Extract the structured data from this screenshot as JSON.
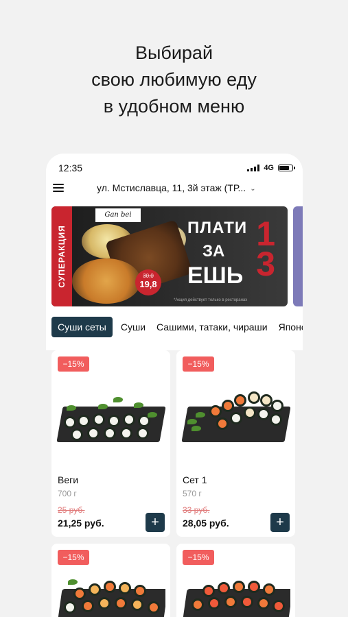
{
  "headline": {
    "line1": "Выбирай",
    "line2": "свою любимую еду",
    "line3": "в удобном меню"
  },
  "status_bar": {
    "time": "12:35",
    "network": "4G"
  },
  "app_bar": {
    "address": "ул. Мстиславца, 11, 3й этаж (ТР...",
    "menu_icon": "hamburger-icon",
    "dropdown_icon": "chevron-down-icon"
  },
  "banner": {
    "side_label": "СУПЕРАКЦИЯ",
    "logo_text": "Gan bei",
    "price_old": "30,0",
    "price_new": "19,8",
    "promo_line1": "ПЛАТИ",
    "promo_line2": "ЗА",
    "promo_line3": "ЕШЬ",
    "promo_number1": "1",
    "promo_number2": "3",
    "note": "*Акция действует только в ресторанах"
  },
  "categories": [
    {
      "label": "Суши сеты",
      "active": true
    },
    {
      "label": "Суши",
      "active": false
    },
    {
      "label": "Сашими, татаки, чираши",
      "active": false
    },
    {
      "label": "Японс",
      "active": false
    }
  ],
  "products": [
    {
      "discount": "−15%",
      "name": "Веги",
      "weight": "700 г",
      "old_price": "25 руб.",
      "price": "21,25 руб.",
      "add_label": "+"
    },
    {
      "discount": "−15%",
      "name": "Сет 1",
      "weight": "570 г",
      "old_price": "33 руб.",
      "price": "28,05 руб.",
      "add_label": "+"
    },
    {
      "discount": "−15%"
    },
    {
      "discount": "−15%"
    }
  ],
  "colors": {
    "accent": "#1e3a4a",
    "discount": "#f15d5d",
    "promo_red": "#c9252f"
  }
}
